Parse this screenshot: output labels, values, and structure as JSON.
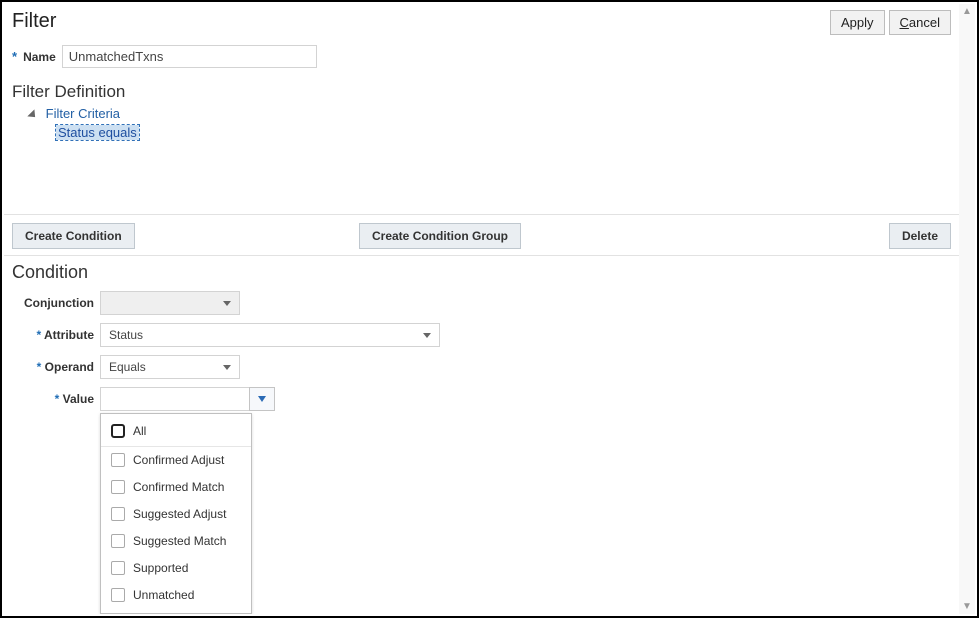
{
  "header": {
    "pageTitle": "Filter",
    "applyLabel": "Apply",
    "cancelInitial": "C",
    "cancelRest": "ancel"
  },
  "name": {
    "label": "Name",
    "value": "UnmatchedTxns"
  },
  "filterDefinition": {
    "title": "Filter Definition",
    "rootLabel": "Filter Criteria",
    "childLabel": "Status equals"
  },
  "actions": {
    "createCondition": "Create Condition",
    "createConditionGroup": "Create Condition Group",
    "delete": "Delete"
  },
  "condition": {
    "title": "Condition",
    "conjunctionLabel": "Conjunction",
    "conjunctionValue": "",
    "attributeLabel": "Attribute",
    "attributeValue": "Status",
    "operandLabel": "Operand",
    "operandValue": "Equals",
    "valueLabel": "Value",
    "valueValue": ""
  },
  "valueDropdown": {
    "options": {
      "0": "All",
      "1": "Confirmed Adjust",
      "2": "Confirmed Match",
      "3": "Suggested Adjust",
      "4": "Suggested Match",
      "5": "Supported",
      "6": "Unmatched"
    }
  }
}
